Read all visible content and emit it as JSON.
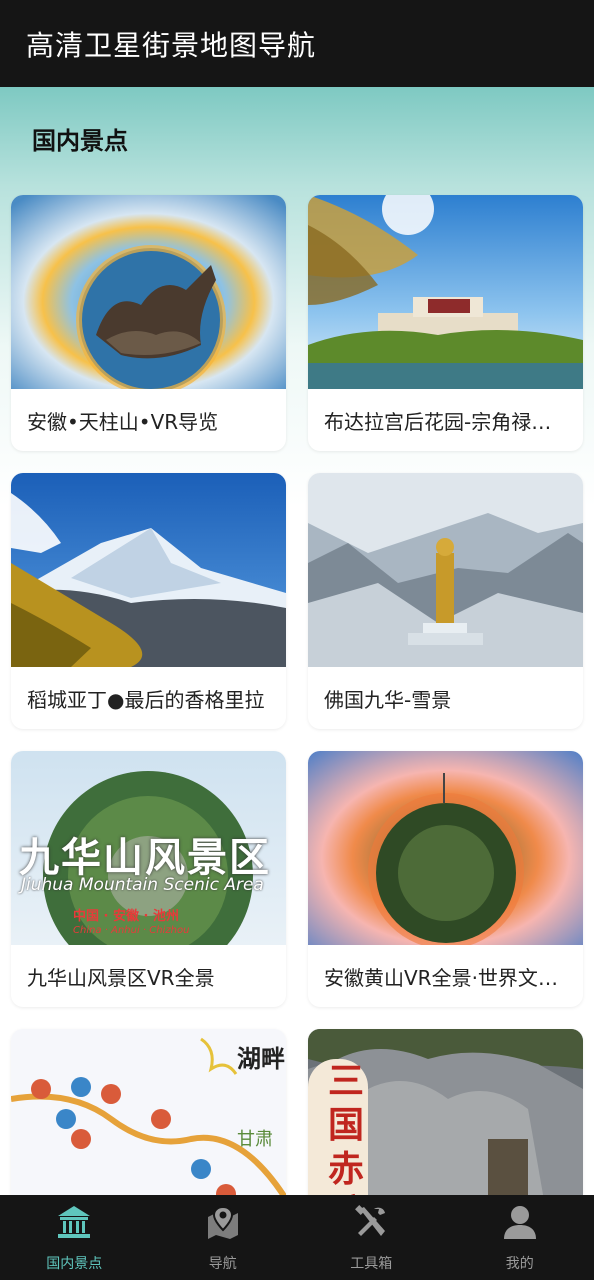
{
  "app": {
    "title": "高清卫星街景地图导航"
  },
  "section": {
    "title": "国内景点"
  },
  "cards": [
    {
      "caption": "安徽•天柱山•VR导览"
    },
    {
      "caption": "布达拉宫后花园-宗角禄康公园"
    },
    {
      "caption": "稻城亚丁●最后的香格里拉"
    },
    {
      "caption": "佛国九华-雪景"
    },
    {
      "caption": "九华山风景区VR全景",
      "overlay": {
        "title": "九华山风景区",
        "subtitle": "Jiuhua Mountain Scenic Area",
        "line1": "中国 · 安徽 · 池州",
        "line2": "China · Anhui · Chizhou"
      }
    },
    {
      "caption": "安徽黄山VR全景·世界文化与自然遗产"
    },
    {
      "caption": "",
      "overlay": {
        "title": "湖畔",
        "label": "甘肃"
      }
    },
    {
      "caption": "",
      "overlay": {
        "title": "三国赤壁"
      }
    }
  ],
  "tabs": [
    {
      "label": "国内景点",
      "icon": "temple-icon",
      "active": true
    },
    {
      "label": "导航",
      "icon": "map-pin-icon",
      "active": false
    },
    {
      "label": "工具箱",
      "icon": "tools-icon",
      "active": false
    },
    {
      "label": "我的",
      "icon": "user-icon",
      "active": false
    }
  ],
  "colors": {
    "titlebar": "#151515",
    "accent": "#5fc6bd",
    "tab_inactive": "#9a9a9a"
  }
}
